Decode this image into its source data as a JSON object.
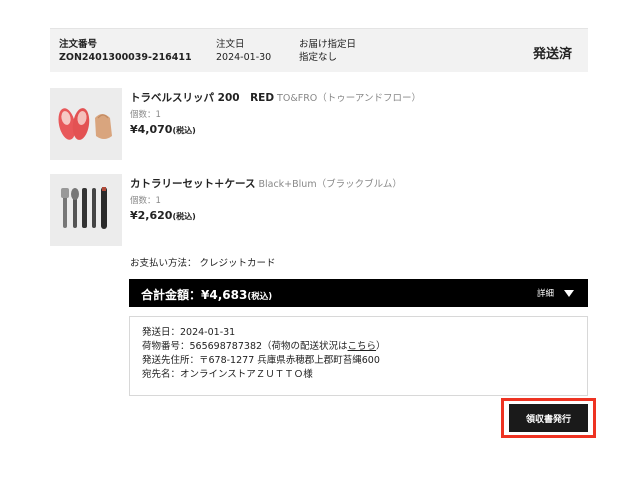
{
  "order": {
    "number_label": "注文番号",
    "number": "ZON2401300039-216411",
    "date_label": "注文日",
    "date": "2024-01-30",
    "delivery_label": "お届け指定日",
    "delivery": "指定なし",
    "status": "発送済"
  },
  "products": [
    {
      "name": "トラベルスリッパ 200　RED",
      "brand": "TO&FRO（トゥーアンドフロー）",
      "qty": "個数：1",
      "price": "¥4,070",
      "tax": "(税込)",
      "thumb_icon": "slippers-image"
    },
    {
      "name": "カトラリーセット＋ケース",
      "brand": "Black+Blum（ブラックブルム）",
      "qty": "個数：1",
      "price": "¥2,620",
      "tax": "(税込)",
      "thumb_icon": "cutlery-image"
    }
  ],
  "payment": "お支払い方法： クレジットカード",
  "total": {
    "label": "合計金額：¥4,683",
    "tax": "(税込)",
    "detail": "詳細",
    "toggle_icon": "triangle-down-icon"
  },
  "shipping": {
    "date": "発送日：2024-01-31",
    "tracking_prefix": "荷物番号：565698787382（荷物の配送状況は",
    "tracking_link": "こちら",
    "tracking_suffix": "）",
    "address": "発送先住所：〒678-1277 兵庫県赤穂郡上郡町苔縄600",
    "recipient": "宛先名：オンラインストアＺＵＴＴＯ様"
  },
  "receipt_button": "領収書発行",
  "colors": {
    "header_bg": "#f2f2f2",
    "total_bar_bg": "#000000",
    "highlight_border": "#ee3322",
    "slipper_red": "#e8585a"
  }
}
